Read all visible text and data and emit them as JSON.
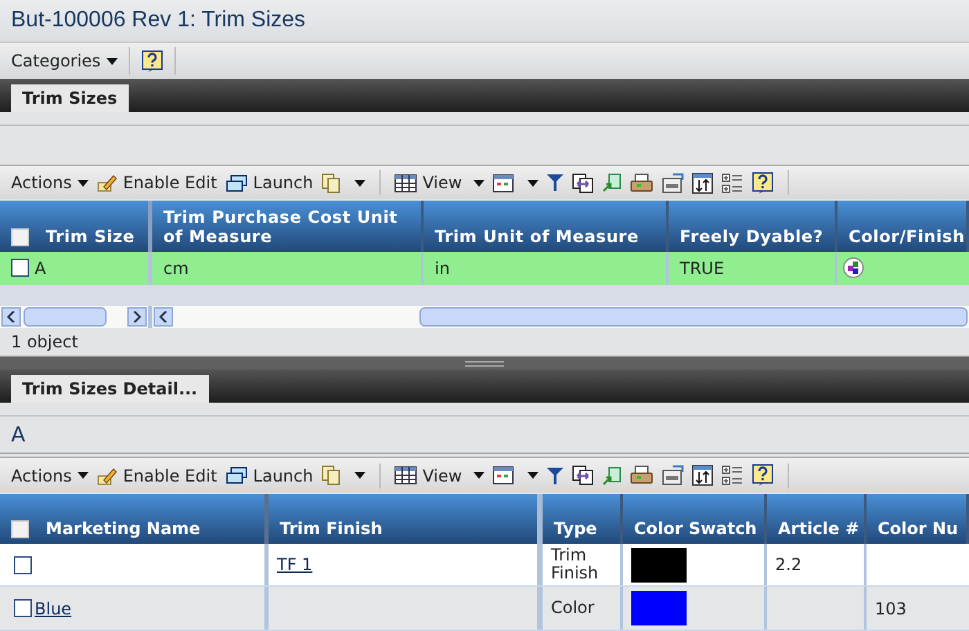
{
  "window": {
    "title": "But-100006 Rev 1: Trim Sizes"
  },
  "menu_bar": {
    "items": [
      "Categories"
    ]
  },
  "top_tabs": [
    {
      "label": "Trim Sizes",
      "selected": true
    }
  ],
  "top_toolbar": {
    "actions": "Actions",
    "enable_edit": "Enable Edit",
    "launch": "Launch",
    "view": "View"
  },
  "top_table": {
    "select_all_checked": false,
    "columns": [
      "Trim Size",
      "Trim Purchase Cost Unit of Measure",
      "Trim Unit of Measure",
      "Freely Dyable?",
      "Color/Finish"
    ],
    "rows": [
      {
        "checked": false,
        "selected": true,
        "cells": [
          "A",
          "cm",
          "in",
          "TRUE"
        ]
      }
    ],
    "status": "1 object"
  },
  "detail_tabs": [
    {
      "label": "Trim Sizes Detail...",
      "selected": true
    }
  ],
  "detail_heading": "A",
  "detail_toolbar": {
    "actions": "Actions",
    "enable_edit": "Enable Edit",
    "launch": "Launch",
    "view": "View"
  },
  "detail_table": {
    "select_all_checked": false,
    "columns": [
      "Marketing Name",
      "Trim Finish",
      "Type",
      "Color Swatch",
      "Article #",
      "Color Nu"
    ],
    "rows": [
      {
        "checked": false,
        "marketing_name": "",
        "trim_finish": "TF 1",
        "type": "Trim Finish",
        "color": "#000000",
        "article": "2.2",
        "color_number": ""
      },
      {
        "checked": false,
        "marketing_name": "Blue",
        "trim_finish": "",
        "type": "Color",
        "color": "#0000ff",
        "article": "",
        "color_number": "103"
      }
    ]
  }
}
